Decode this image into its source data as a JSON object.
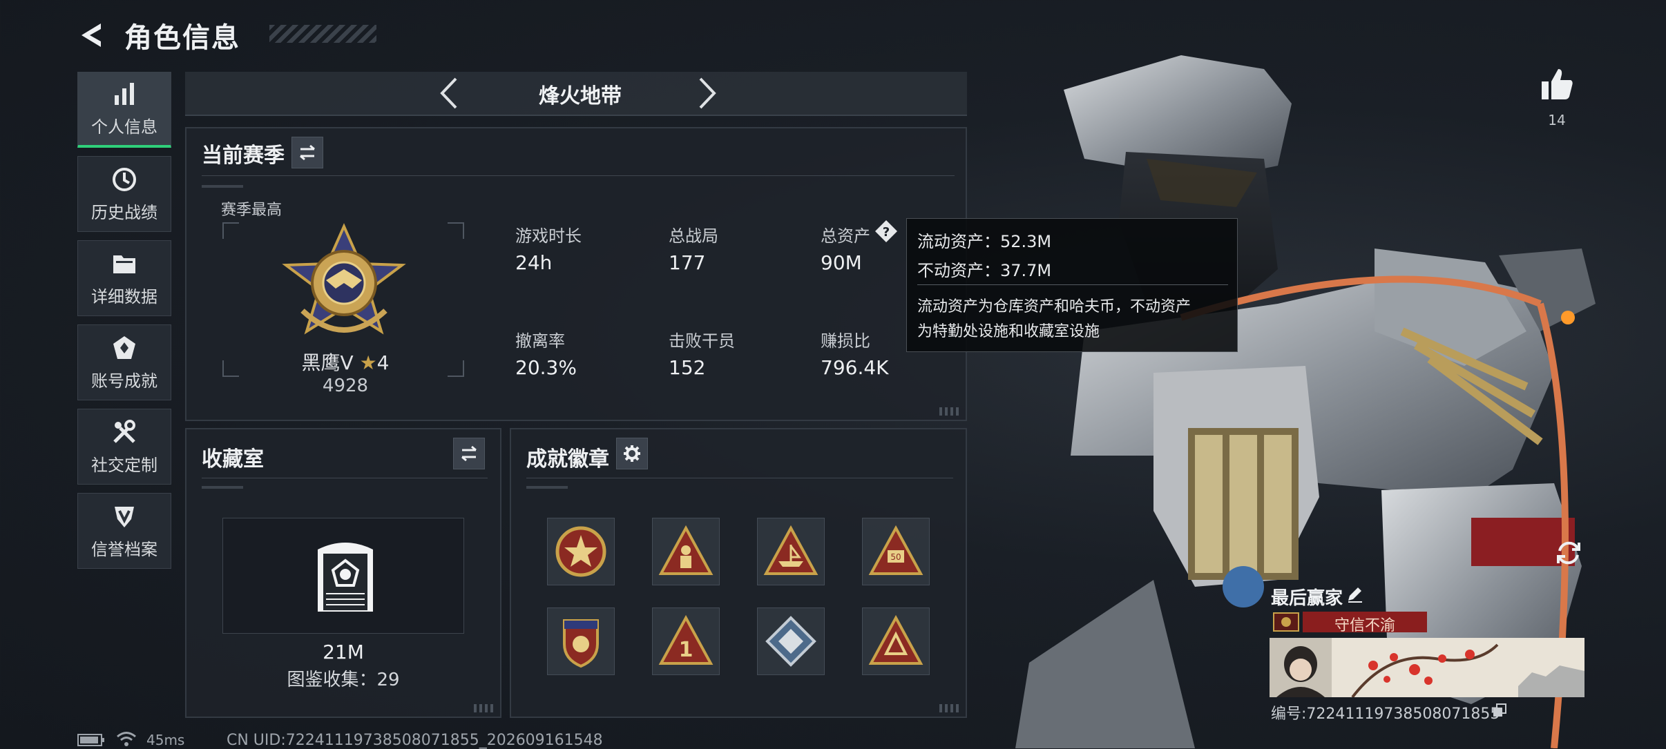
{
  "header": {
    "title": "角色信息"
  },
  "sidebar": {
    "items": [
      {
        "label": "个人信息",
        "icon": "bar-chart-icon",
        "active": true
      },
      {
        "label": "历史战绩",
        "icon": "clock-history-icon",
        "active": false
      },
      {
        "label": "详细数据",
        "icon": "folder-icon",
        "active": false
      },
      {
        "label": "账号成就",
        "icon": "achievement-icon",
        "active": false
      },
      {
        "label": "社交定制",
        "icon": "tools-icon",
        "active": false
      },
      {
        "label": "信誉档案",
        "icon": "shield-file-icon",
        "active": false
      }
    ]
  },
  "mode": {
    "name": "烽火地带"
  },
  "season": {
    "title": "当前赛季",
    "best_label": "赛季最高",
    "rank_name": "黑鹰V",
    "rank_stars": "4",
    "rank_score": "4928",
    "stats": [
      {
        "label": "游戏时长",
        "value": "24h"
      },
      {
        "label": "总战局",
        "value": "177"
      },
      {
        "label": "总资产",
        "value": "90M"
      },
      {
        "label": "撤离率",
        "value": "20.3%"
      },
      {
        "label": "击败干员",
        "value": "152"
      },
      {
        "label": "赚损比",
        "value": "796.4K"
      }
    ]
  },
  "tooltip": {
    "line1": "流动资产：52.3M",
    "line2": "不动资产：37.7M",
    "desc1": "流动资产为仓库资产和哈夫币，不动资产",
    "desc2": "为特勤处设施和收藏室设施"
  },
  "vault": {
    "title": "收藏室",
    "value": "21M",
    "collection": "图鉴收集：29"
  },
  "badges": {
    "title": "成就徽章",
    "items": [
      "star-seal-badge",
      "soldier-triangle-badge",
      "ship-triangle-badge",
      "rank-50-triangle-badge",
      "eagle-shield-badge",
      "number-1-triangle-badge",
      "diamond-emblem-badge",
      "hazard-triangle-badge"
    ]
  },
  "profile": {
    "likes": "14",
    "card_name": "最后赢家",
    "motto": "守信不渝",
    "card_id": "编号:72241119738508071855"
  },
  "status": {
    "ping": "45ms",
    "uid": "CN UID:72241119738508071855_202609161548"
  },
  "colors": {
    "accent_green": "#2fd07a",
    "motto_red": "#8a1e1e",
    "gold": "#c9a24a"
  }
}
